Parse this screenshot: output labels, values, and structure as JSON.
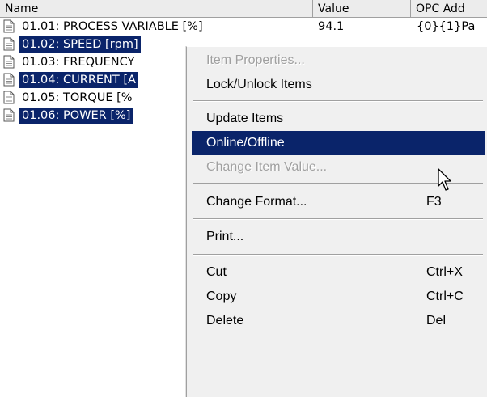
{
  "columns": {
    "name": "Name",
    "value": "Value",
    "opc": "OPC Add"
  },
  "rows": [
    {
      "name": "01.01: PROCESS VARIABLE [%]",
      "value": "94.1",
      "opc": "{0}{1}Pa",
      "selected": false
    },
    {
      "name": "01.02: SPEED [rpm]",
      "value": "",
      "opc": "",
      "selected": true
    },
    {
      "name": "01.03: FREQUENCY",
      "value": "",
      "opc": "",
      "selected": false
    },
    {
      "name": "01.04: CURRENT [A",
      "value": "",
      "opc": "",
      "selected": true
    },
    {
      "name": "01.05: TORQUE [%",
      "value": "",
      "opc": "",
      "selected": false
    },
    {
      "name": "01.06: POWER [%]",
      "value": "",
      "opc": "",
      "selected": true
    }
  ],
  "menu": {
    "item_properties": "Item Properties...",
    "lock_unlock": "Lock/Unlock Items",
    "update_items": "Update Items",
    "online_offline": "Online/Offline",
    "change_item_value": "Change Item Value...",
    "change_format": "Change Format...",
    "change_format_shortcut": "F3",
    "print": "Print...",
    "cut": "Cut",
    "cut_shortcut": "Ctrl+X",
    "copy": "Copy",
    "copy_shortcut": "Ctrl+C",
    "delete": "Delete",
    "delete_shortcut": "Del"
  },
  "icons": {
    "row_icon": "document-icon",
    "cursor": "mouse-pointer-icon"
  },
  "colors": {
    "selection": "#0a246a",
    "menu_background": "#f0f0f0",
    "disabled_text": "#a0a0a0"
  }
}
